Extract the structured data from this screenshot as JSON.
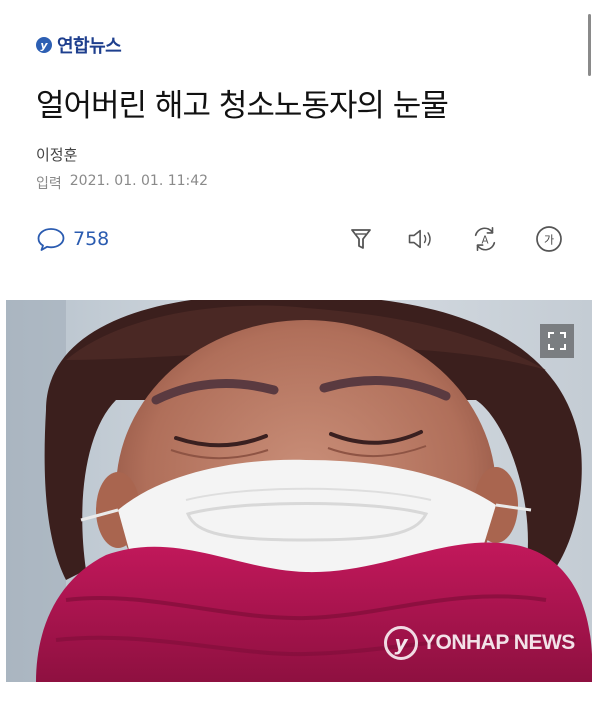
{
  "brand": {
    "mark": "y",
    "name": "연합뉴스"
  },
  "article": {
    "headline": "얼어버린 해고 청소노동자의 눈물",
    "author": "이정훈",
    "date_label": "입력",
    "date_value": "2021. 01. 01. 11:42"
  },
  "toolbar": {
    "comment_count": "758",
    "translate_glyph": "A",
    "font_glyph": "가"
  },
  "photo": {
    "watermark_logo": "y",
    "watermark_text": "YONHAP NEWS"
  },
  "colors": {
    "brand_blue": "#1e3f8e",
    "comment_blue": "#2a5bb0",
    "scarf": "#b3124f",
    "mask": "#f4f4f4"
  },
  "icons": [
    "comment-icon",
    "filter-icon",
    "speaker-icon",
    "translate-icon",
    "font-size-icon",
    "expand-icon"
  ]
}
